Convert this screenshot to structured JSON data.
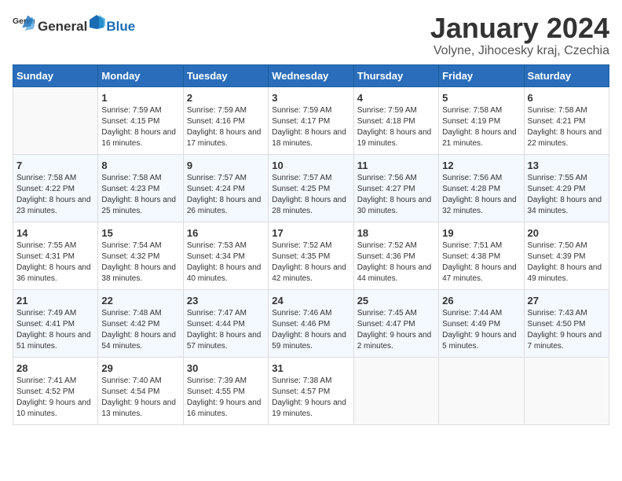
{
  "header": {
    "logo_general": "General",
    "logo_blue": "Blue",
    "title": "January 2024",
    "subtitle": "Volyne, Jihocesky kraj, Czechia"
  },
  "days_of_week": [
    "Sunday",
    "Monday",
    "Tuesday",
    "Wednesday",
    "Thursday",
    "Friday",
    "Saturday"
  ],
  "weeks": [
    [
      {
        "day": "",
        "empty": true
      },
      {
        "day": "1",
        "sunrise": "7:59 AM",
        "sunset": "4:15 PM",
        "daylight": "8 hours and 16 minutes."
      },
      {
        "day": "2",
        "sunrise": "7:59 AM",
        "sunset": "4:16 PM",
        "daylight": "8 hours and 17 minutes."
      },
      {
        "day": "3",
        "sunrise": "7:59 AM",
        "sunset": "4:17 PM",
        "daylight": "8 hours and 18 minutes."
      },
      {
        "day": "4",
        "sunrise": "7:59 AM",
        "sunset": "4:18 PM",
        "daylight": "8 hours and 19 minutes."
      },
      {
        "day": "5",
        "sunrise": "7:58 AM",
        "sunset": "4:19 PM",
        "daylight": "8 hours and 21 minutes."
      },
      {
        "day": "6",
        "sunrise": "7:58 AM",
        "sunset": "4:21 PM",
        "daylight": "8 hours and 22 minutes."
      }
    ],
    [
      {
        "day": "7",
        "sunrise": "7:58 AM",
        "sunset": "4:22 PM",
        "daylight": "8 hours and 23 minutes."
      },
      {
        "day": "8",
        "sunrise": "7:58 AM",
        "sunset": "4:23 PM",
        "daylight": "8 hours and 25 minutes."
      },
      {
        "day": "9",
        "sunrise": "7:57 AM",
        "sunset": "4:24 PM",
        "daylight": "8 hours and 26 minutes."
      },
      {
        "day": "10",
        "sunrise": "7:57 AM",
        "sunset": "4:25 PM",
        "daylight": "8 hours and 28 minutes."
      },
      {
        "day": "11",
        "sunrise": "7:56 AM",
        "sunset": "4:27 PM",
        "daylight": "8 hours and 30 minutes."
      },
      {
        "day": "12",
        "sunrise": "7:56 AM",
        "sunset": "4:28 PM",
        "daylight": "8 hours and 32 minutes."
      },
      {
        "day": "13",
        "sunrise": "7:55 AM",
        "sunset": "4:29 PM",
        "daylight": "8 hours and 34 minutes."
      }
    ],
    [
      {
        "day": "14",
        "sunrise": "7:55 AM",
        "sunset": "4:31 PM",
        "daylight": "8 hours and 36 minutes."
      },
      {
        "day": "15",
        "sunrise": "7:54 AM",
        "sunset": "4:32 PM",
        "daylight": "8 hours and 38 minutes."
      },
      {
        "day": "16",
        "sunrise": "7:53 AM",
        "sunset": "4:34 PM",
        "daylight": "8 hours and 40 minutes."
      },
      {
        "day": "17",
        "sunrise": "7:52 AM",
        "sunset": "4:35 PM",
        "daylight": "8 hours and 42 minutes."
      },
      {
        "day": "18",
        "sunrise": "7:52 AM",
        "sunset": "4:36 PM",
        "daylight": "8 hours and 44 minutes."
      },
      {
        "day": "19",
        "sunrise": "7:51 AM",
        "sunset": "4:38 PM",
        "daylight": "8 hours and 47 minutes."
      },
      {
        "day": "20",
        "sunrise": "7:50 AM",
        "sunset": "4:39 PM",
        "daylight": "8 hours and 49 minutes."
      }
    ],
    [
      {
        "day": "21",
        "sunrise": "7:49 AM",
        "sunset": "4:41 PM",
        "daylight": "8 hours and 51 minutes."
      },
      {
        "day": "22",
        "sunrise": "7:48 AM",
        "sunset": "4:42 PM",
        "daylight": "8 hours and 54 minutes."
      },
      {
        "day": "23",
        "sunrise": "7:47 AM",
        "sunset": "4:44 PM",
        "daylight": "8 hours and 57 minutes."
      },
      {
        "day": "24",
        "sunrise": "7:46 AM",
        "sunset": "4:46 PM",
        "daylight": "8 hours and 59 minutes."
      },
      {
        "day": "25",
        "sunrise": "7:45 AM",
        "sunset": "4:47 PM",
        "daylight": "9 hours and 2 minutes."
      },
      {
        "day": "26",
        "sunrise": "7:44 AM",
        "sunset": "4:49 PM",
        "daylight": "9 hours and 5 minutes."
      },
      {
        "day": "27",
        "sunrise": "7:43 AM",
        "sunset": "4:50 PM",
        "daylight": "9 hours and 7 minutes."
      }
    ],
    [
      {
        "day": "28",
        "sunrise": "7:41 AM",
        "sunset": "4:52 PM",
        "daylight": "9 hours and 10 minutes."
      },
      {
        "day": "29",
        "sunrise": "7:40 AM",
        "sunset": "4:54 PM",
        "daylight": "9 hours and 13 minutes."
      },
      {
        "day": "30",
        "sunrise": "7:39 AM",
        "sunset": "4:55 PM",
        "daylight": "9 hours and 16 minutes."
      },
      {
        "day": "31",
        "sunrise": "7:38 AM",
        "sunset": "4:57 PM",
        "daylight": "9 hours and 19 minutes."
      },
      {
        "day": "",
        "empty": true
      },
      {
        "day": "",
        "empty": true
      },
      {
        "day": "",
        "empty": true
      }
    ]
  ]
}
